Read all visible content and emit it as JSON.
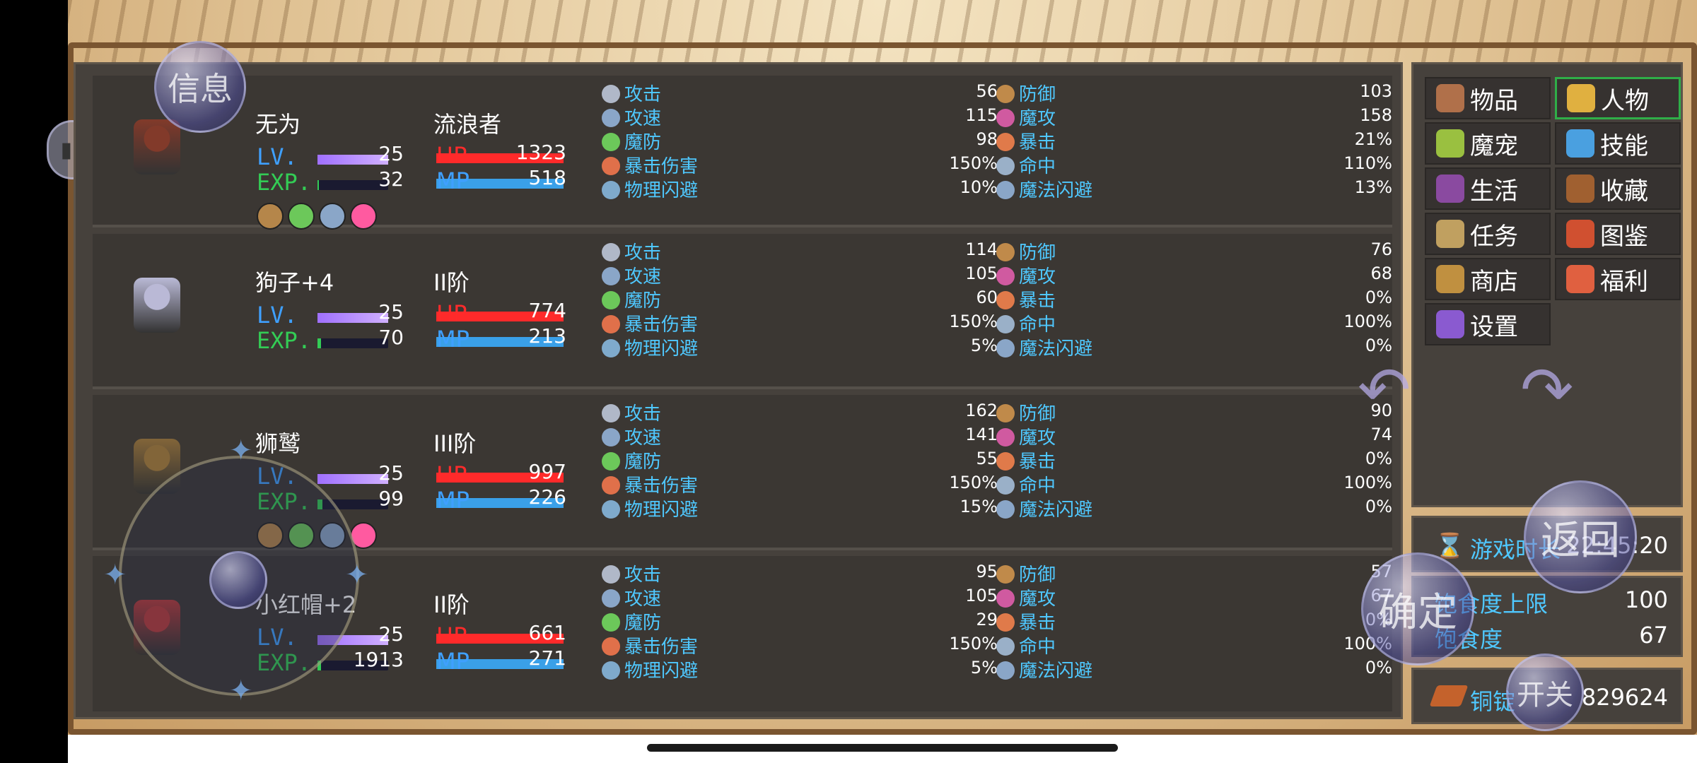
{
  "overlay": {
    "info_btn": "信息",
    "back_btn": "返回",
    "confirm_btn": "确定",
    "toggle_btn": "开关"
  },
  "characters": [
    {
      "name": "无为",
      "class": "流浪者",
      "lv_label": "LV.",
      "exp_label": "EXP.",
      "hp_label": "HP",
      "mp_label": "MP",
      "lv": "25",
      "exp": "32",
      "hp": "1323",
      "mp": "518",
      "exp_fill": 0.02,
      "has_buffs": true,
      "stats_left": [
        {
          "label": "攻击",
          "value": "56",
          "icon": "sword-icon"
        },
        {
          "label": "攻速",
          "value": "115",
          "icon": "speed-icon"
        },
        {
          "label": "魔防",
          "value": "98",
          "icon": "magic-defense-icon"
        },
        {
          "label": "暴击伤害",
          "value": "150%",
          "icon": "crit-damage-icon"
        },
        {
          "label": "物理闪避",
          "value": "10%",
          "icon": "dodge-icon"
        }
      ],
      "stats_right": [
        {
          "label": "防御",
          "value": "103",
          "icon": "shield-icon"
        },
        {
          "label": "魔攻",
          "value": "158",
          "icon": "magic-attack-icon"
        },
        {
          "label": "暴击",
          "value": "21%",
          "icon": "crit-icon"
        },
        {
          "label": "命中",
          "value": "110%",
          "icon": "hit-icon"
        },
        {
          "label": "魔法闪避",
          "value": "13%",
          "icon": "magic-dodge-icon"
        }
      ]
    },
    {
      "name": "狗子+4",
      "class": "II阶",
      "lv_label": "LV.",
      "exp_label": "EXP.",
      "hp_label": "HP",
      "mp_label": "MP",
      "lv": "25",
      "exp": "70",
      "hp": "774",
      "mp": "213",
      "exp_fill": 0.05,
      "has_buffs": false,
      "stats_left": [
        {
          "label": "攻击",
          "value": "114",
          "icon": "sword-icon"
        },
        {
          "label": "攻速",
          "value": "105",
          "icon": "speed-icon"
        },
        {
          "label": "魔防",
          "value": "60",
          "icon": "magic-defense-icon"
        },
        {
          "label": "暴击伤害",
          "value": "150%",
          "icon": "crit-damage-icon"
        },
        {
          "label": "物理闪避",
          "value": "5%",
          "icon": "dodge-icon"
        }
      ],
      "stats_right": [
        {
          "label": "防御",
          "value": "76",
          "icon": "shield-icon"
        },
        {
          "label": "魔攻",
          "value": "68",
          "icon": "magic-attack-icon"
        },
        {
          "label": "暴击",
          "value": "0%",
          "icon": "crit-icon"
        },
        {
          "label": "命中",
          "value": "100%",
          "icon": "hit-icon"
        },
        {
          "label": "魔法闪避",
          "value": "0%",
          "icon": "magic-dodge-icon"
        }
      ]
    },
    {
      "name": "狮鹫",
      "class": "III阶",
      "lv_label": "LV.",
      "exp_label": "EXP.",
      "hp_label": "HP",
      "mp_label": "MP",
      "lv": "25",
      "exp": "99",
      "hp": "997",
      "mp": "226",
      "exp_fill": 0.07,
      "has_buffs": true,
      "stats_left": [
        {
          "label": "攻击",
          "value": "162",
          "icon": "sword-icon"
        },
        {
          "label": "攻速",
          "value": "141",
          "icon": "speed-icon"
        },
        {
          "label": "魔防",
          "value": "55",
          "icon": "magic-defense-icon"
        },
        {
          "label": "暴击伤害",
          "value": "150%",
          "icon": "crit-damage-icon"
        },
        {
          "label": "物理闪避",
          "value": "15%",
          "icon": "dodge-icon"
        }
      ],
      "stats_right": [
        {
          "label": "防御",
          "value": "90",
          "icon": "shield-icon"
        },
        {
          "label": "魔攻",
          "value": "74",
          "icon": "magic-attack-icon"
        },
        {
          "label": "暴击",
          "value": "0%",
          "icon": "crit-icon"
        },
        {
          "label": "命中",
          "value": "100%",
          "icon": "hit-icon"
        },
        {
          "label": "魔法闪避",
          "value": "0%",
          "icon": "magic-dodge-icon"
        }
      ]
    },
    {
      "name": "小红帽+2",
      "class": "II阶",
      "lv_label": "LV.",
      "exp_label": "EXP.",
      "hp_label": "HP",
      "mp_label": "MP",
      "lv": "25",
      "exp": "1913",
      "hp": "661",
      "mp": "271",
      "exp_fill": 0.05,
      "has_buffs": false,
      "stats_left": [
        {
          "label": "攻击",
          "value": "95",
          "icon": "sword-icon"
        },
        {
          "label": "攻速",
          "value": "105",
          "icon": "speed-icon"
        },
        {
          "label": "魔防",
          "value": "29",
          "icon": "magic-defense-icon"
        },
        {
          "label": "暴击伤害",
          "value": "150%",
          "icon": "crit-damage-icon"
        },
        {
          "label": "物理闪避",
          "value": "5%",
          "icon": "dodge-icon"
        }
      ],
      "stats_right": [
        {
          "label": "防御",
          "value": "57",
          "icon": "shield-icon"
        },
        {
          "label": "魔攻",
          "value": "67",
          "icon": "magic-attack-icon"
        },
        {
          "label": "暴击",
          "value": "0%",
          "icon": "crit-icon"
        },
        {
          "label": "命中",
          "value": "100%",
          "icon": "hit-icon"
        },
        {
          "label": "魔法闪避",
          "value": "0%",
          "icon": "magic-dodge-icon"
        }
      ]
    }
  ],
  "menu": [
    {
      "label": "物品",
      "icon": "bag-icon",
      "active": false
    },
    {
      "label": "人物",
      "icon": "character-icon",
      "active": true
    },
    {
      "label": "魔宠",
      "icon": "egg-icon",
      "active": false
    },
    {
      "label": "技能",
      "icon": "skill-icon",
      "active": false
    },
    {
      "label": "生活",
      "icon": "life-icon",
      "active": false
    },
    {
      "label": "收藏",
      "icon": "collection-icon",
      "active": false
    },
    {
      "label": "任务",
      "icon": "quest-icon",
      "active": false
    },
    {
      "label": "图鉴",
      "icon": "book-icon",
      "active": false
    },
    {
      "label": "商店",
      "icon": "shop-icon",
      "active": false
    },
    {
      "label": "福利",
      "icon": "gift-icon",
      "active": false
    },
    {
      "label": "设置",
      "icon": "settings-icon",
      "active": false
    }
  ],
  "info": {
    "playtime_label": "游戏时长",
    "playtime": "22:45:20",
    "satiety_max_label": "饱食度上限",
    "satiety_max": "100",
    "satiety_label": "饱食度",
    "satiety": "67",
    "copper_label": "铜锭",
    "copper": "829624"
  },
  "colors": {
    "stat_label": "#4fc8ff",
    "hp": "#ff2a2a",
    "mp": "#3aa0e8",
    "lv": "#3fa0ff",
    "exp": "#33cc55",
    "active_menu_border": "#2fae48"
  }
}
